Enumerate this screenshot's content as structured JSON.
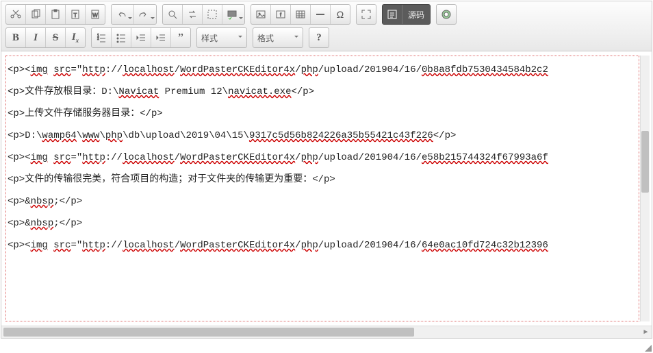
{
  "toolbar": {
    "r1": {
      "cut": "cut",
      "copy": "copy",
      "paste": "paste",
      "pastetext": "paste-text",
      "pasteword": "paste-word",
      "undo": "undo",
      "redo": "redo",
      "find": "find",
      "replace": "replace",
      "selectall": "select-all",
      "spell": "spellcheck",
      "image": "image",
      "flash": "flash",
      "table": "table",
      "hr": "horizontal-rule",
      "specialchar": "special-char",
      "maximize": "maximize",
      "source": "源码",
      "about": "about"
    },
    "r2": {
      "bold": "B",
      "italic": "I",
      "strike": "S",
      "removefmt": "Ix",
      "numlist": "numbered-list",
      "bullist": "bullet-list",
      "outdent": "outdent",
      "indent": "indent",
      "blockquote": "blockquote",
      "styles": "样式",
      "format": "格式",
      "help": "?"
    }
  },
  "source": {
    "lines": [
      {
        "pre": "<p><",
        "u1": "img",
        "mid1": " ",
        "u2": "src",
        "mid2": "=\"",
        "u3": "http",
        "mid3": "://",
        "u4": "localhost",
        "mid4": "/",
        "u5": "WordPasterCKEditor4x",
        "mid5": "/",
        "u6": "php",
        "mid6": "/upload/201904/16/",
        "u7": "0b8a8fdb7530434584b2c2",
        "post": ""
      },
      {
        "pre": "<p>文件存放根目录：D:\\",
        "u1": "Navicat",
        "mid1": " Premium 12\\",
        "u2": "navicat.exe",
        "post": "</p>"
      },
      {
        "pre": "<p>上传文件存储服务器目录：</p>",
        "post": ""
      },
      {
        "pre": "<p>D:\\",
        "u1": "wamp64",
        "mid1": "\\",
        "u2": "www",
        "mid2": "\\",
        "u3": "php",
        "mid3": "\\db\\upload\\2019\\04\\15\\",
        "u4": "9317c5d56b824226a35b55421c43f226",
        "post": "</p>"
      },
      {
        "pre": "<p><",
        "u1": "img",
        "mid1": " ",
        "u2": "src",
        "mid2": "=\"",
        "u3": "http",
        "mid3": "://",
        "u4": "localhost",
        "mid4": "/",
        "u5": "WordPasterCKEditor4x",
        "mid5": "/",
        "u6": "php",
        "mid6": "/upload/201904/16/",
        "u7": "e58b215744324f67993a6f",
        "post": ""
      },
      {
        "pre": "<p>文件的传输很完美，符合项目的构造；对于文件夹的传输更为重要：</p>",
        "post": ""
      },
      {
        "pre": "<p>&",
        "u1": "nbsp",
        "post": ";</p>"
      },
      {
        "pre": "<p>&",
        "u1": "nbsp",
        "post": ";</p>"
      },
      {
        "pre": "<p><",
        "u1": "img",
        "mid1": " ",
        "u2": "src",
        "mid2": "=\"",
        "u3": "http",
        "mid3": "://",
        "u4": "localhost",
        "mid4": "/",
        "u5": "WordPasterCKEditor4x",
        "mid5": "/",
        "u6": "php",
        "mid6": "/upload/201904/16/",
        "u7": "64e0ac10fd724c32b12396",
        "post": ""
      }
    ]
  }
}
